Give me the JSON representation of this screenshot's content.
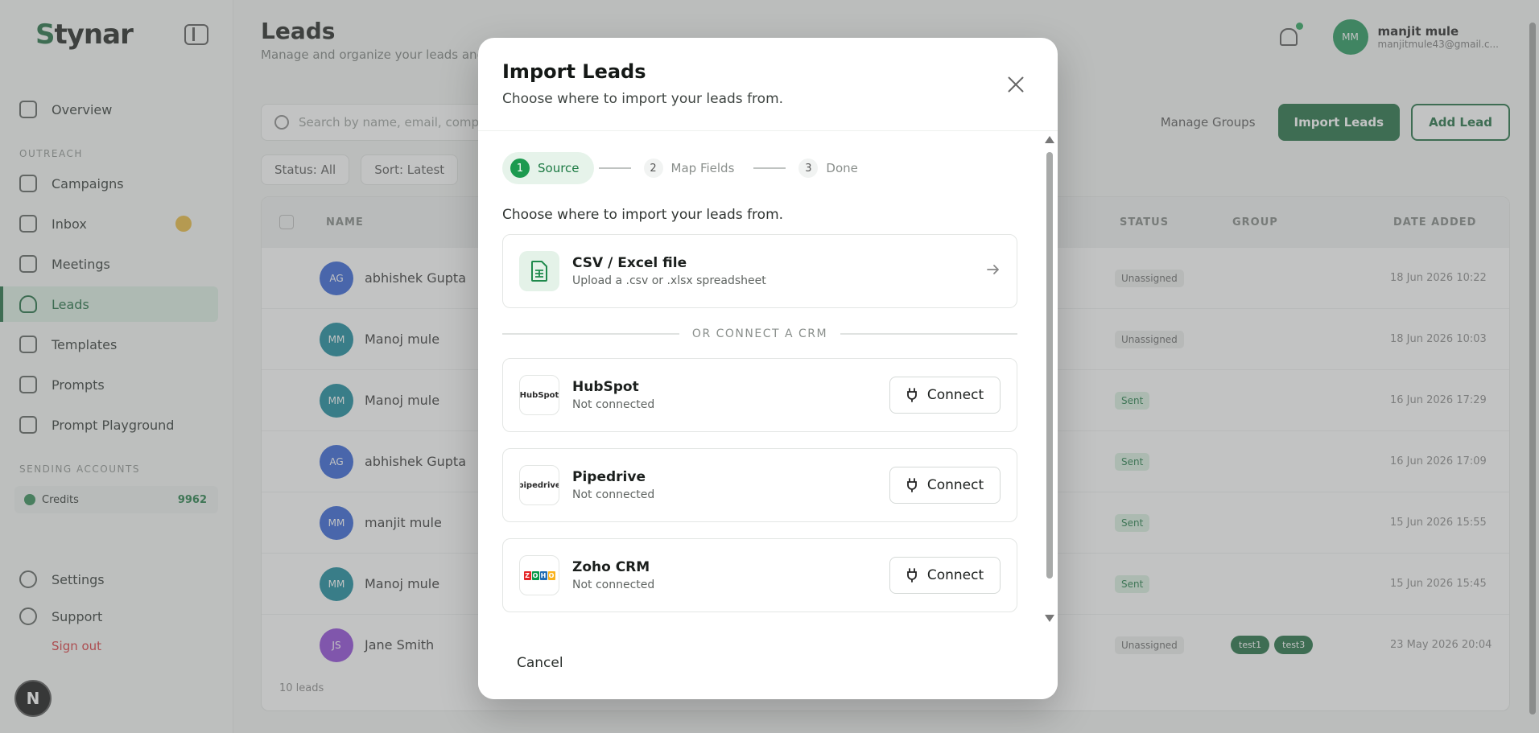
{
  "sidebar": {
    "brand_letter": "S",
    "brand_rest": "tynar",
    "items": [
      {
        "label": "Overview"
      },
      {
        "label": "Campaigns"
      },
      {
        "label": "Inbox"
      },
      {
        "label": "Meetings"
      },
      {
        "label": "Leads"
      },
      {
        "label": "Templates"
      },
      {
        "label": "Prompts"
      },
      {
        "label": "Prompt Playground"
      }
    ],
    "section_outreach": "OUTREACH",
    "section_accounts": "SENDING ACCOUNTS",
    "credits_label": "Credits",
    "credits_value": "9962",
    "settings": "Settings",
    "support": "Support",
    "signout": "Sign out",
    "bubble": "N"
  },
  "header": {
    "title": "Leads",
    "subtitle": "Manage and organize your leads and contacts",
    "user_initials": "MM",
    "user_name": "manjit mule",
    "user_email": "manjitmule43@gmail.c..."
  },
  "toolbar": {
    "search_placeholder": "Search by name, email, company...",
    "manage_groups": "Manage Groups",
    "import_leads": "Import Leads",
    "add_lead": "Add Lead",
    "filter_status": "Status: All",
    "filter_sort": "Sort: Latest"
  },
  "table": {
    "col_name": "NAME",
    "col_status": "STATUS",
    "col_group": "GROUP",
    "col_date": "DATE ADDED",
    "rows": [
      {
        "initials": "AG",
        "name": "abhishek Gupta",
        "status": "Unassigned",
        "date": "18 Jun 2026 10:22",
        "color": "#2f5fd6"
      },
      {
        "initials": "MM",
        "name": "Manoj mule",
        "status": "Unassigned",
        "date": "18 Jun 2026 10:03",
        "color": "#14879a"
      },
      {
        "initials": "MM",
        "name": "Manoj mule",
        "status": "Sent",
        "date": "16 Jun 2026 17:29",
        "color": "#14879a"
      },
      {
        "initials": "AG",
        "name": "abhishek Gupta",
        "status": "Sent",
        "date": "16 Jun 2026 17:09",
        "color": "#2f5fd6"
      },
      {
        "initials": "MM",
        "name": "manjit mule",
        "status": "Sent",
        "date": "15 Jun 2026 15:55",
        "color": "#2f5fd6"
      },
      {
        "initials": "MM",
        "name": "Manoj mule",
        "status": "Sent",
        "date": "15 Jun 2026 15:45",
        "color": "#14879a"
      },
      {
        "initials": "JS",
        "name": "Jane Smith",
        "status": "Unassigned",
        "date": "23 May 2026 20:04",
        "color": "#8e44d8",
        "groups": [
          "test1",
          "test3"
        ]
      }
    ],
    "footer": "10 leads"
  },
  "modal": {
    "title": "Import Leads",
    "subtitle": "Choose where to import your leads from.",
    "steps": [
      {
        "num": "1",
        "label": "Source"
      },
      {
        "num": "2",
        "label": "Map Fields"
      },
      {
        "num": "3",
        "label": "Done"
      }
    ],
    "body_text": "Choose where to import your leads from.",
    "csv_title": "CSV / Excel file",
    "csv_sub": "Upload a .csv or .xlsx spreadsheet",
    "divider": "OR CONNECT A CRM",
    "crms": [
      {
        "name": "HubSpot",
        "status": "Not connected",
        "logo_text": "HubSpot"
      },
      {
        "name": "Pipedrive",
        "status": "Not connected",
        "logo_text": "pipedrive"
      },
      {
        "name": "Zoho CRM",
        "status": "Not connected",
        "logo_text": "ZOHO"
      }
    ],
    "connect_label": "Connect",
    "cancel_label": "Cancel"
  },
  "colors": {
    "brand_green": "#1c6b3e",
    "step_active": "#1c9a4f",
    "overlay": "rgba(110,113,111,0.42)"
  }
}
